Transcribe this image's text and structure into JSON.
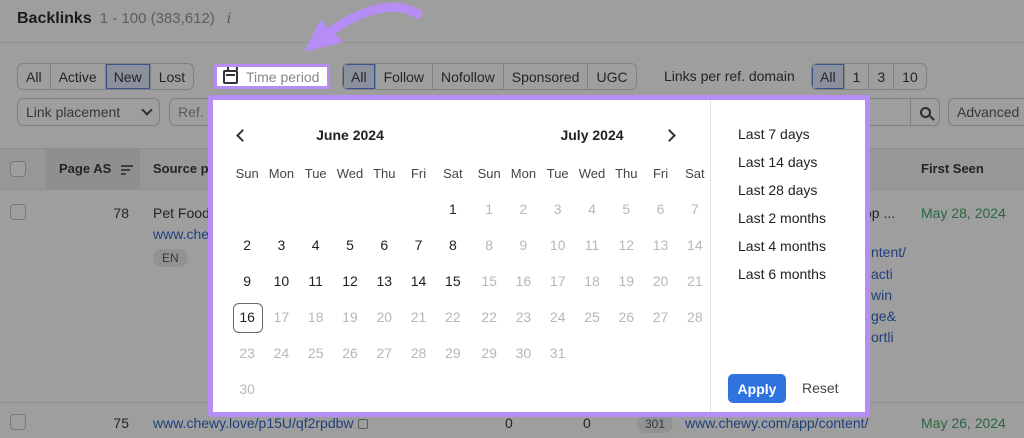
{
  "header": {
    "title": "Backlinks",
    "count": "1 - 100 (383,612)",
    "info_icon": "i"
  },
  "filters": {
    "status": [
      {
        "label": "All",
        "active": false
      },
      {
        "label": "Active",
        "active": false
      },
      {
        "label": "New",
        "active": true
      },
      {
        "label": "Lost",
        "active": false
      }
    ],
    "time_period": {
      "label": "Time period",
      "icon": "calendar-icon"
    },
    "link_type": [
      {
        "label": "All",
        "active": true
      },
      {
        "label": "Follow",
        "active": false
      },
      {
        "label": "Nofollow",
        "active": false
      },
      {
        "label": "Sponsored",
        "active": false
      },
      {
        "label": "UGC",
        "active": false
      }
    ],
    "links_per_domain_label": "Links per ref. domain",
    "links_per_domain": [
      {
        "label": "All",
        "active": true
      },
      {
        "label": "1",
        "active": false
      },
      {
        "label": "3",
        "active": false
      },
      {
        "label": "10",
        "active": false
      }
    ],
    "link_placement": "Link placement",
    "ref_placeholder": "Ref. p",
    "advanced": "Advanced"
  },
  "table": {
    "headers": {
      "page_as": "Page AS",
      "source": "Source pa",
      "first_seen": "First Seen"
    },
    "rows": [
      {
        "page_as": "78",
        "source_title": "Pet Food",
        "source_url": "www.che",
        "lang": "EN",
        "target_snippet": "op ...",
        "target_lines": [
          "ntent/",
          "acti",
          "win",
          "ge&",
          "ortli"
        ],
        "first_seen": "May 28, 2024"
      },
      {
        "page_as": "75",
        "source_url": "www.chewy.love/p15U/qf2rpdbw",
        "col_a": "0",
        "col_b": "0",
        "status_code": "301",
        "target_url": "www.chewy.com/app/content/",
        "first_seen": "May 26, 2024"
      }
    ]
  },
  "datepicker": {
    "left_month": {
      "title": "June 2024",
      "leading_blanks": 6,
      "days_in_month": 30,
      "enabled_until": 16,
      "today": 16
    },
    "right_month": {
      "title": "July 2024",
      "leading_blanks": 0,
      "days_in_month": 31,
      "enabled_until": 0
    },
    "weekdays": [
      "Sun",
      "Mon",
      "Tue",
      "Wed",
      "Thu",
      "Fri",
      "Sat"
    ],
    "presets": [
      "Last 7 days",
      "Last 14 days",
      "Last 28 days",
      "Last 2 months",
      "Last 4 months",
      "Last 6 months"
    ],
    "apply": "Apply",
    "reset": "Reset"
  },
  "colors": {
    "highlight": "#b58df5",
    "apply": "#2f73e0",
    "date_green": "#2e9a57",
    "link_blue": "#1a53c4"
  }
}
